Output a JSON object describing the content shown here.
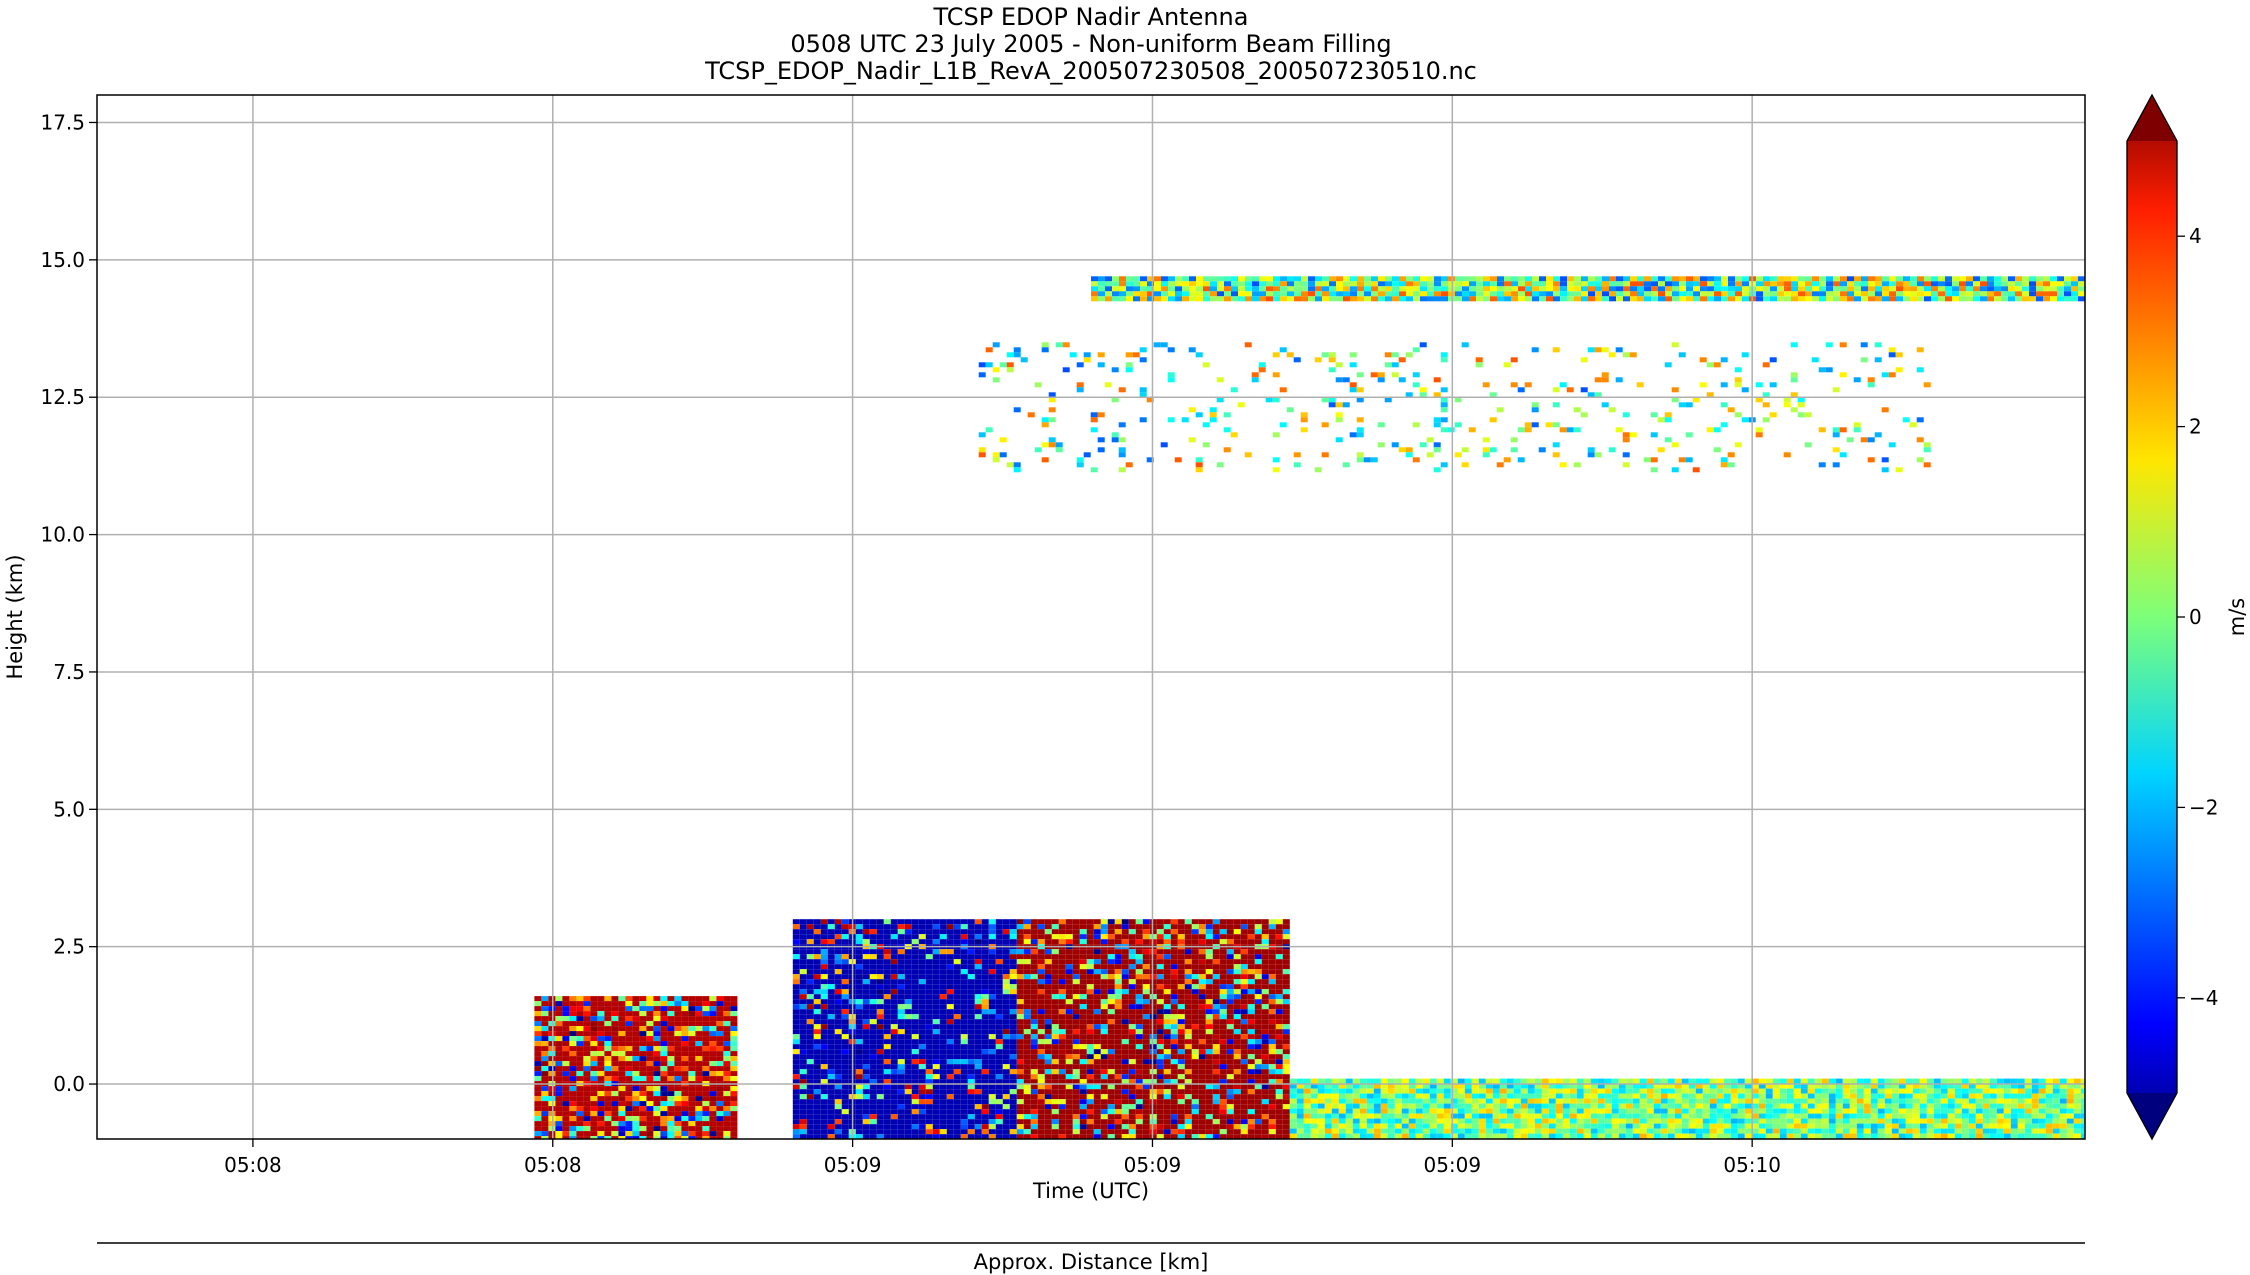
{
  "chart_data": {
    "type": "heatmap",
    "title_lines": [
      "TCSP EDOP Nadir Antenna",
      "0508 UTC 23 July 2005 - Non-uniform Beam Filling",
      "TCSP_EDOP_Nadir_L1B_RevA_200507230508_200507230510.nc"
    ],
    "xlabel": "Time (UTC)",
    "ylabel": "Height (km)",
    "secondary_xlabel": "Approx. Distance [km]",
    "x_tick_labels": [
      "05:08",
      "05:08",
      "05:09",
      "05:09",
      "05:09",
      "05:10"
    ],
    "ylim": [
      -1.0,
      18.0
    ],
    "y_ticks": [
      0.0,
      2.5,
      5.0,
      7.5,
      10.0,
      12.5,
      15.0,
      17.5
    ],
    "y_tick_labels": [
      "0.0",
      "2.5",
      "5.0",
      "7.5",
      "10.0",
      "12.5",
      "15.0",
      "17.5"
    ],
    "grid": true,
    "colorbar": {
      "label": "m/s",
      "range": [
        -5,
        5
      ],
      "extend": "both",
      "colormap": "jet",
      "ticks": [
        4,
        2,
        0,
        -2,
        -4
      ],
      "tick_labels": [
        "4",
        "2",
        "0",
        "−2",
        "−4"
      ]
    },
    "field_description_notes": [],
    "regions": [
      {
        "x": [
          0.22,
          0.32
        ],
        "y": [
          -1.0,
          1.6
        ],
        "fill": "mixed"
      },
      {
        "x": [
          0.35,
          0.6
        ],
        "y": [
          -1.0,
          3.0
        ],
        "fill": "mixed"
      },
      {
        "x": [
          0.6,
          1.0
        ],
        "y": [
          -1.0,
          0.1
        ],
        "fill": "mixed"
      },
      {
        "x": [
          0.5,
          1.0
        ],
        "y": [
          14.3,
          14.7
        ],
        "fill": "mixed"
      },
      {
        "x": [
          0.44,
          0.92
        ],
        "y": [
          11.2,
          13.5
        ],
        "fill": "sparse"
      }
    ]
  }
}
